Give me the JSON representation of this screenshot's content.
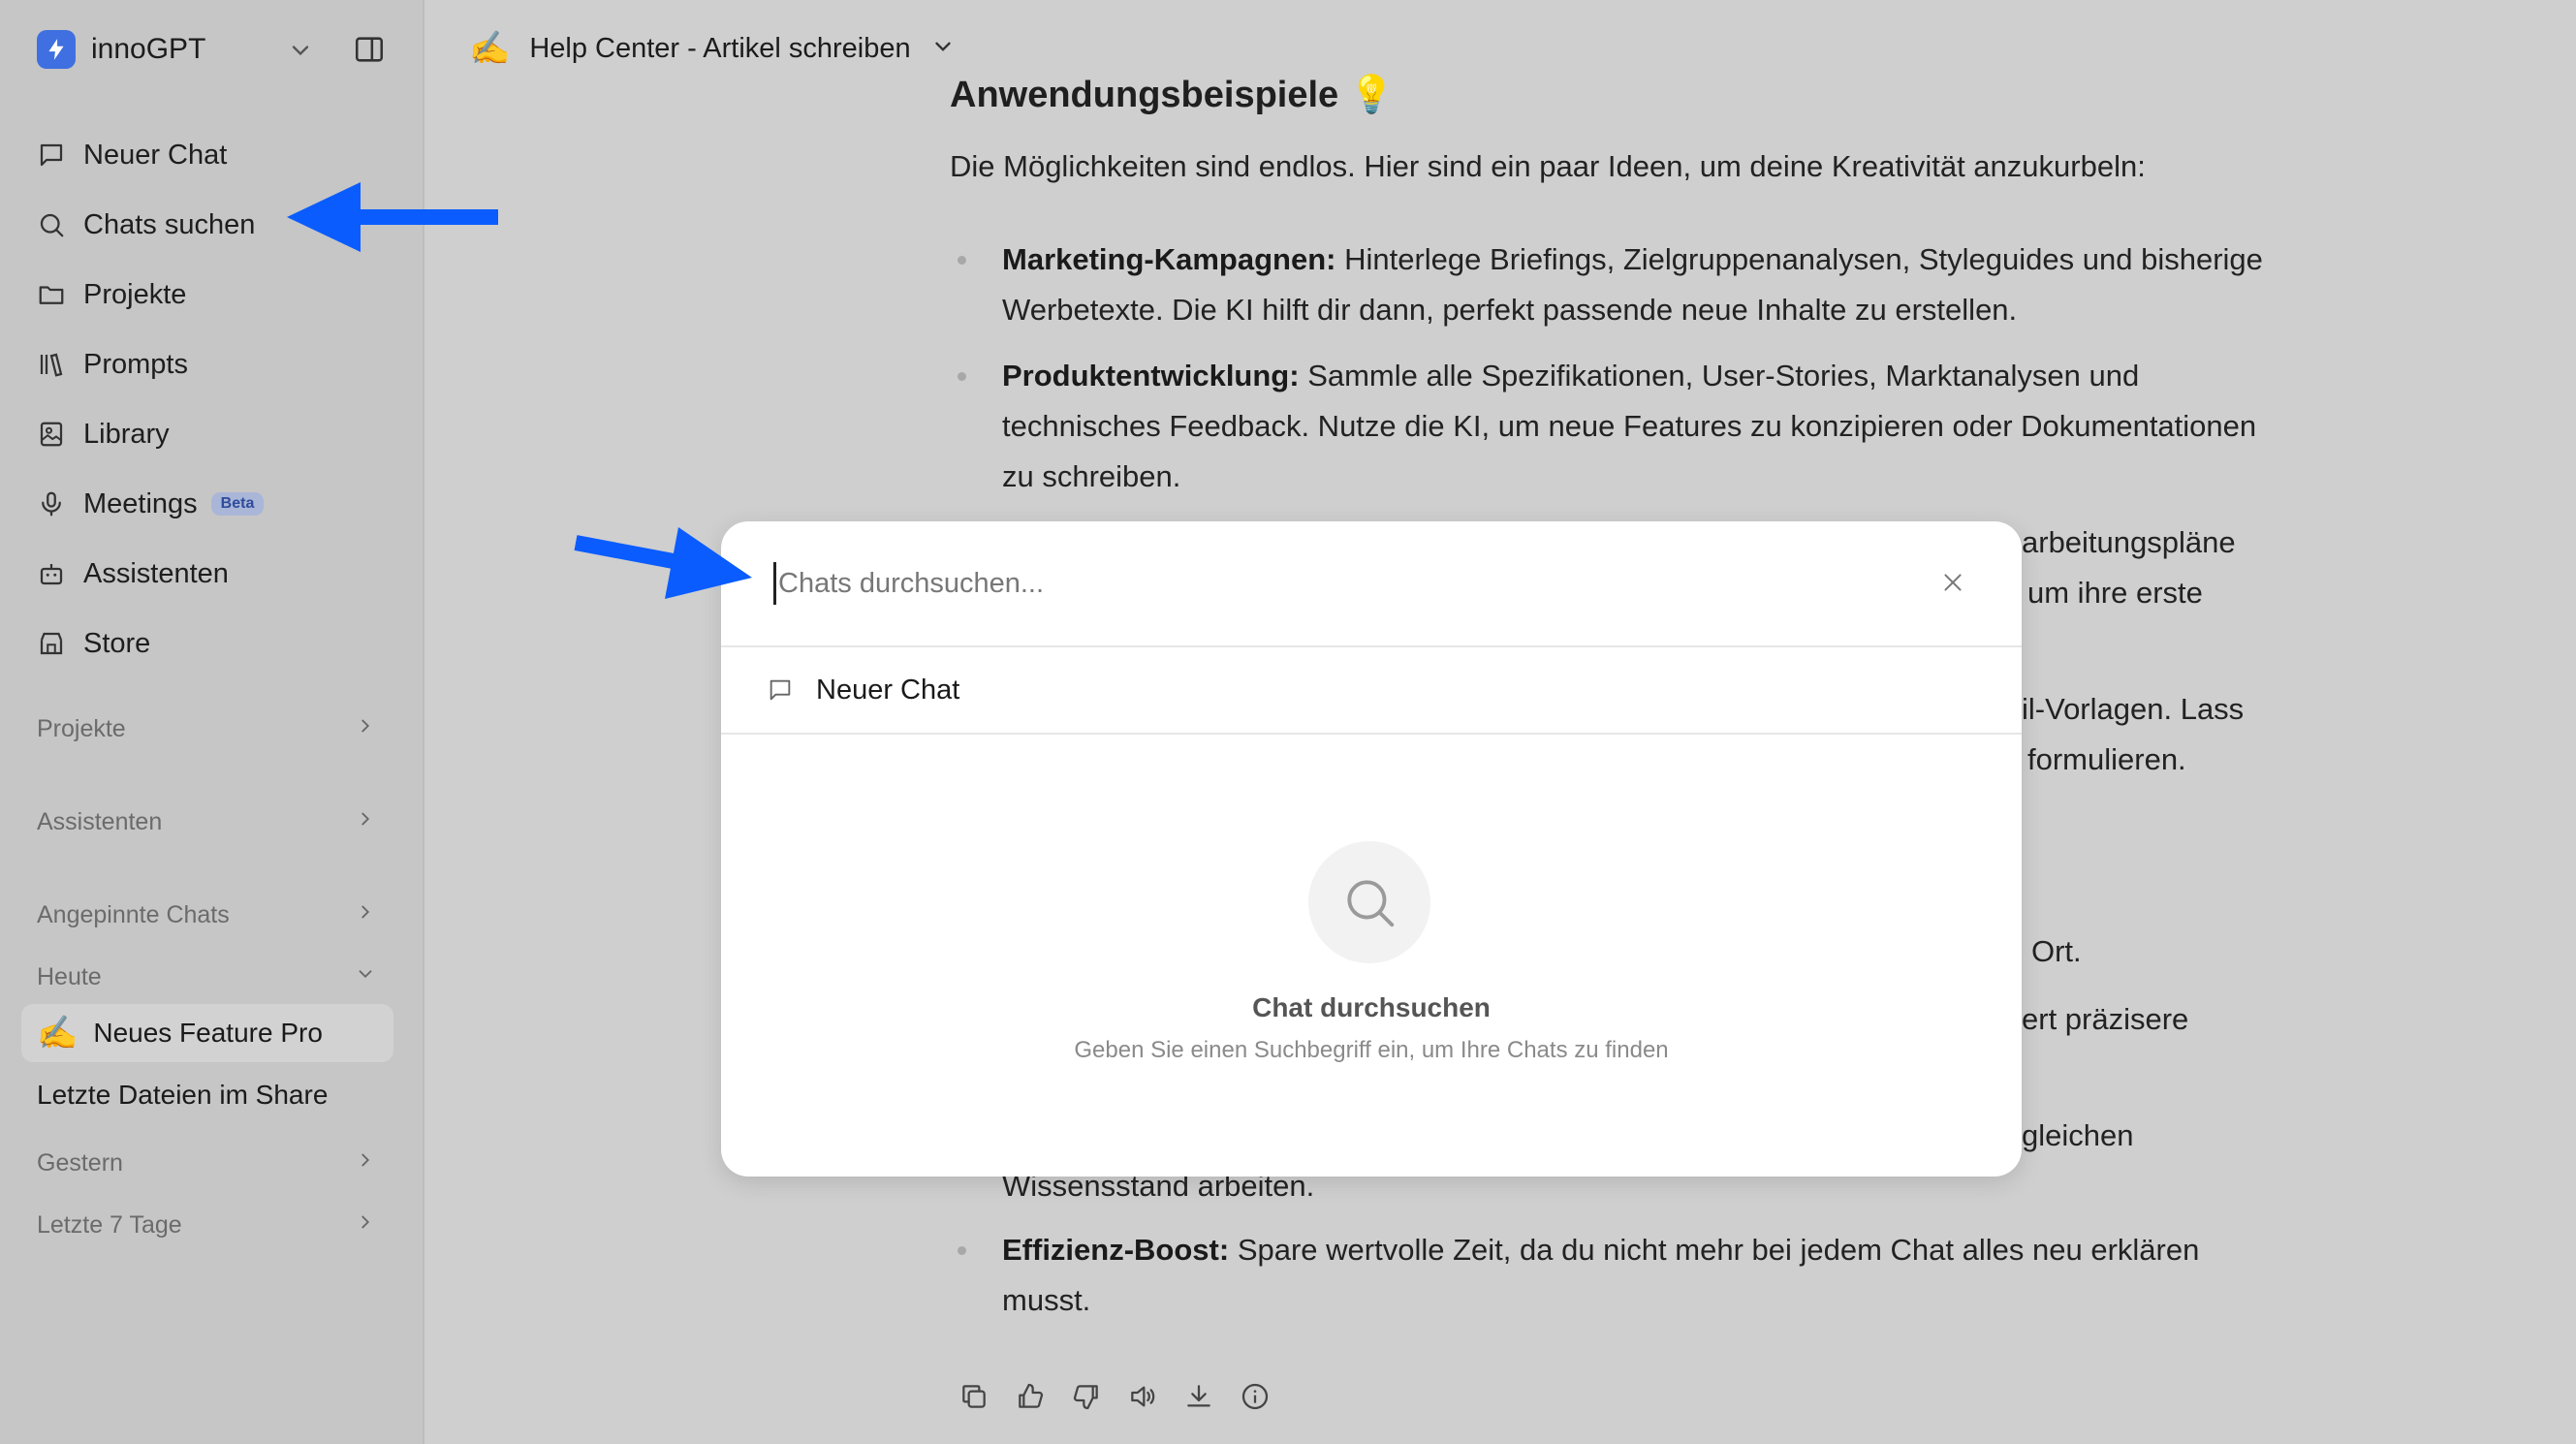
{
  "app": {
    "name": "innoGPT"
  },
  "sidebar": {
    "nav": [
      {
        "label": "Neuer Chat"
      },
      {
        "label": "Chats suchen"
      },
      {
        "label": "Projekte"
      },
      {
        "label": "Prompts"
      },
      {
        "label": "Library"
      },
      {
        "label": "Meetings",
        "badge": "Beta"
      },
      {
        "label": "Assistenten"
      },
      {
        "label": "Store"
      }
    ],
    "sections": {
      "projects": "Projekte",
      "assistants": "Assistenten",
      "pinned": "Angepinnte Chats",
      "today": "Heute",
      "yesterday": "Gestern",
      "last7": "Letzte 7 Tage"
    },
    "today_chats": [
      {
        "emoji": "✍️",
        "title": "Neues Feature Pro"
      },
      {
        "title": "Letzte Dateien im Share"
      }
    ]
  },
  "header": {
    "emoji": "✍️",
    "title": "Help Center - Artikel schreiben"
  },
  "article": {
    "heading": "Anwendungsbeispiele 💡",
    "intro": "Die Möglichkeiten sind endlos. Hier sind ein paar Ideen, um deine Kreativität anzukurbeln:",
    "bullets": [
      {
        "bold": "Marketing-Kampagnen:",
        "text": " Hinterlege Briefings, Zielgruppenanalysen, Styleguides und bisherige Werbetexte. Die KI hilft dir dann, perfekt passende neue Inhalte zu erstellen."
      },
      {
        "bold": "Produktentwicklung:",
        "text": " Sammle alle Spezifikationen, User-Stories, Marktanalysen und technisches Feedback. Nutze die KI, um neue Features zu konzipieren oder Dokumentationen zu schreiben."
      }
    ],
    "fragments": {
      "f1": "arbeitungspläne",
      "f2": "um ihre erste",
      "f3": "il-Vorlagen. Lass",
      "f4": "formulieren.",
      "f5": "Ort.",
      "f6": "ert präzisere",
      "f7": "gleichen",
      "f8": "Wissensstand arbeiten."
    },
    "last_bullet": {
      "bold": "Effizienz-Boost:",
      "text": " Spare wertvolle Zeit, da du nicht mehr bei jedem Chat alles neu erklären musst."
    }
  },
  "modal": {
    "search_placeholder": "Chats durchsuchen...",
    "result": "Neuer Chat",
    "empty_title": "Chat durchsuchen",
    "empty_subtitle": "Geben Sie einen Suchbegriff ein, um Ihre Chats zu finden"
  },
  "colors": {
    "accent": "#3f6fe0",
    "arrow": "#0a5cff"
  }
}
